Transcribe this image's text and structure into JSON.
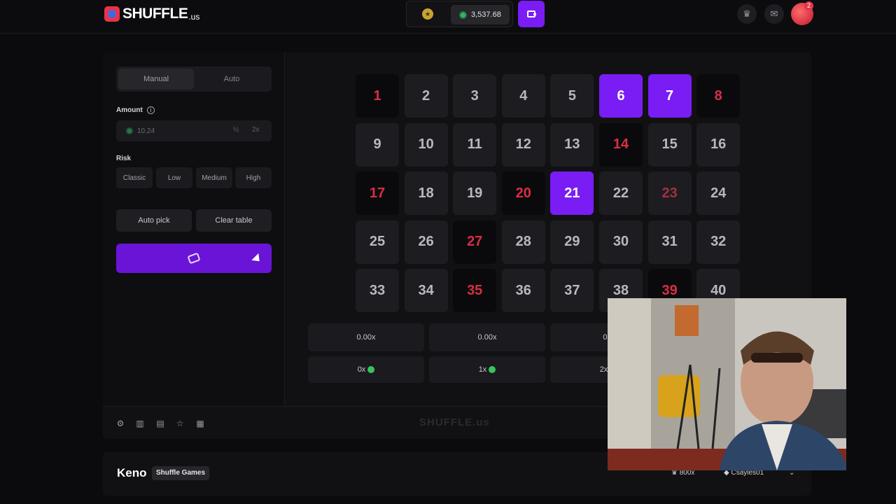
{
  "header": {
    "logo_text": "SHUFFLE",
    "logo_suffix": ".us",
    "balance": "3,537.68",
    "notifications": "2",
    "icons": [
      "coin-icon",
      "wallet-icon",
      "crown-icon",
      "chat-icon"
    ]
  },
  "sidebar": {
    "tabs": [
      {
        "label": "Manual",
        "active": true
      },
      {
        "label": "Auto",
        "active": false
      }
    ],
    "amount_label": "Amount",
    "amount_value": "10.24",
    "half": "½",
    "double": "2x",
    "risk_label": "Risk",
    "risk_options": [
      "Classic",
      "Low",
      "Medium",
      "High"
    ],
    "auto_pick": "Auto pick",
    "clear_table": "Clear table"
  },
  "board": {
    "numbers": [
      "1",
      "2",
      "3",
      "4",
      "5",
      "6",
      "7",
      "8",
      "9",
      "10",
      "11",
      "12",
      "13",
      "14",
      "15",
      "16",
      "17",
      "18",
      "19",
      "20",
      "21",
      "22",
      "23",
      "24",
      "25",
      "26",
      "27",
      "28",
      "29",
      "30",
      "31",
      "32",
      "33",
      "34",
      "35",
      "36",
      "37",
      "38",
      "39",
      "40"
    ],
    "picked": [
      6,
      7,
      21
    ],
    "drawn_misses": [
      1,
      8,
      14,
      17,
      20,
      27,
      35,
      39
    ],
    "dimmed": [
      23
    ]
  },
  "payouts": {
    "multipliers": [
      "0.00x",
      "0.00x",
      "0.0"
    ],
    "hits": [
      "0x",
      "1x",
      "2x"
    ]
  },
  "footer": {
    "watermark": "SHUFFLE.us",
    "icons": [
      "settings-icon",
      "volume-icon",
      "stats-icon",
      "star-icon",
      "fairness-icon"
    ]
  },
  "info": {
    "game": "Keno",
    "provider": "Shuffle Games",
    "max_win": "800x",
    "user": "Csayles01"
  },
  "colors": {
    "accent": "#7a1cf4",
    "miss": "#d92e44",
    "gem": "#37c45a"
  }
}
